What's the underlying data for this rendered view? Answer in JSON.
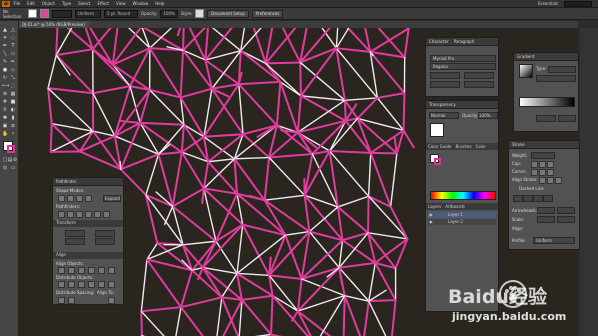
{
  "app": {
    "logo": "Ai",
    "workspace": "Essentials"
  },
  "menu": [
    "File",
    "Edit",
    "Object",
    "Type",
    "Select",
    "Effect",
    "View",
    "Window",
    "Help"
  ],
  "control_bar": {
    "selection_label": "No Selection",
    "stroke_dd": "",
    "uniform_dd": "Uniform",
    "brush_dd": "5 pt. Round",
    "opacity_label": "Opacity:",
    "opacity_value": "100%",
    "style_label": "Style:",
    "doc_setup": "Document Setup",
    "preferences": "Preferences"
  },
  "document_tab": "DJ-01.ai* @ 50% (RGB/Preview)",
  "panels": {
    "character": {
      "tabs": [
        "Character",
        "Paragraph"
      ],
      "font": "Myriad Pro",
      "style": "Regular"
    },
    "gradient": {
      "title": "Gradient",
      "type_label": "Type:"
    },
    "transparency": {
      "title": "Transparency",
      "mode": "Normal",
      "opacity_label": "Opacity:",
      "opacity_value": "100%"
    },
    "swatches": {
      "tabs": [
        "Color Guide",
        "Brushes",
        "Color"
      ]
    },
    "layers": {
      "tabs": [
        "Layers",
        "Artboards"
      ],
      "items": [
        "Layer 1",
        "Layer 2"
      ]
    },
    "stroke": {
      "title": "Stroke",
      "rows": [
        "Weight:",
        "Cap:",
        "Corner:",
        "Align Stroke:"
      ],
      "dashed": "Dashed Line",
      "arrowheads": "Arrowheads:",
      "scale": "Scale:",
      "align": "Align:",
      "profile": "Profile:",
      "profile_value": "Uniform"
    },
    "pathfinder": {
      "title": "Pathfinder",
      "shape_modes": "Shape Modes:",
      "pathfinders": "Pathfinders:",
      "expand": "Expand"
    },
    "transform": {
      "title": "Transform"
    },
    "align": {
      "title": "Align",
      "align_objects": "Align Objects:",
      "distribute_objects": "Distribute Objects:",
      "distribute_spacing": "Distribute Spacing:",
      "align_to": "Align To:"
    }
  },
  "watermark": {
    "brand": "Baidu经验",
    "url": "jingyan.baidu.com"
  }
}
